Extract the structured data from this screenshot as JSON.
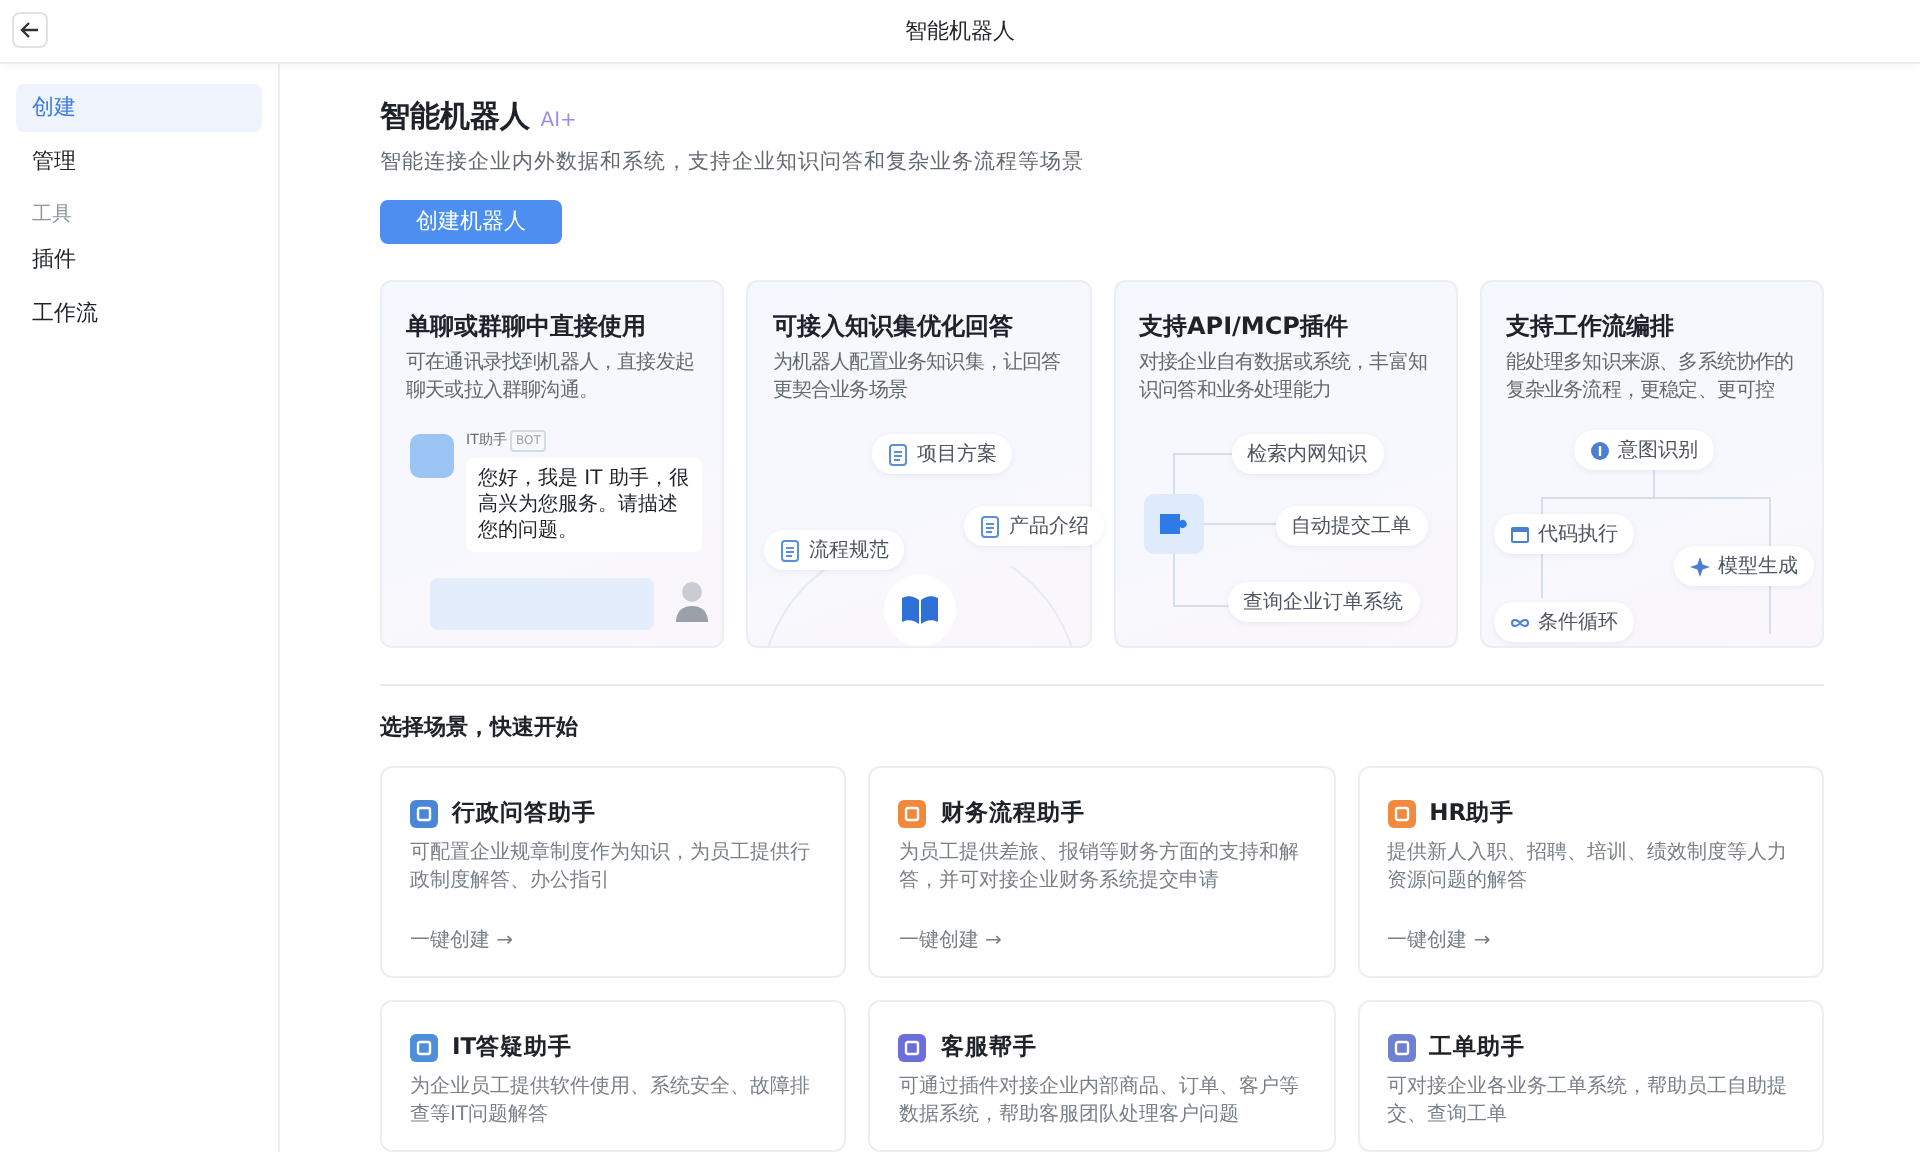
{
  "header": {
    "title": "智能机器人"
  },
  "sidebar": {
    "items": [
      {
        "kind": "item",
        "label": "创建",
        "selected": true
      },
      {
        "kind": "item",
        "label": "管理",
        "selected": false
      },
      {
        "kind": "heading",
        "label": "工具"
      },
      {
        "kind": "item",
        "label": "插件",
        "selected": false
      },
      {
        "kind": "item",
        "label": "工作流",
        "selected": false
      }
    ]
  },
  "intro": {
    "title": "智能机器人",
    "badge": "AI+",
    "subtitle": "智能连接企业内外数据和系统，支持企业知识问答和复杂业务流程等场景",
    "button": "创建机器人"
  },
  "features": [
    {
      "kind": "chat",
      "title": "单聊或群聊中直接使用",
      "description": "可在通讯录找到机器人，直接发起聊天或拉入群聊沟通。",
      "bot_name": "IT助手",
      "bot_tag": "BOT",
      "message": "您好，我是 IT 助手，很高兴为您服务。请描述您的问题。"
    },
    {
      "kind": "knowledge",
      "title": "可接入知识集优化回答",
      "description": "为机器人配置业务知识集，让回答更契合业务场景",
      "chips": [
        "项目方案",
        "产品介绍",
        "流程规范"
      ]
    },
    {
      "kind": "plugin",
      "title": "支持API/MCP插件",
      "description": "对接企业自有数据或系统，丰富知识问答和业务处理能力",
      "chips": [
        "检索内网知识",
        "自动提交工单",
        "查询企业订单系统"
      ]
    },
    {
      "kind": "workflow",
      "title": "支持工作流编排",
      "description": "能处理多知识来源、多系统协作的复杂业务流程，更稳定、更可控",
      "chips": [
        "意图识别",
        "代码执行",
        "模型生成",
        "条件循环"
      ]
    }
  ],
  "scenarios": {
    "title": "选择场景，快速开始",
    "cards": [
      {
        "title": "行政问答助手",
        "description": "可配置企业规章制度作为知识，为员工提供行政制度解答、办公指引",
        "link": "一键创建 →",
        "color": "#4a86d8"
      },
      {
        "title": "财务流程助手",
        "description": "为员工提供差旅、报销等财务方面的支持和解答，并可对接企业财务系统提交申请",
        "link": "一键创建 →",
        "color": "#f0893c"
      },
      {
        "title": "HR助手",
        "description": "提供新人入职、招聘、培训、绩效制度等人力资源问题的解答",
        "link": "一键创建 →",
        "color": "#ef8a3e"
      },
      {
        "title": "IT答疑助手",
        "description": "为企业员工提供软件使用、系统安全、故障排查等IT问题解答",
        "color": "#4d8fd6"
      },
      {
        "title": "客服帮手",
        "description": "可通过插件对接企业内部商品、订单、客户等数据系统，帮助客服团队处理客户问题",
        "color": "#6b6fdc"
      },
      {
        "title": "工单助手",
        "description": "可对接企业各业务工单系统，帮助员工自助提交、查询工单",
        "color": "#6f7fd2"
      }
    ]
  }
}
